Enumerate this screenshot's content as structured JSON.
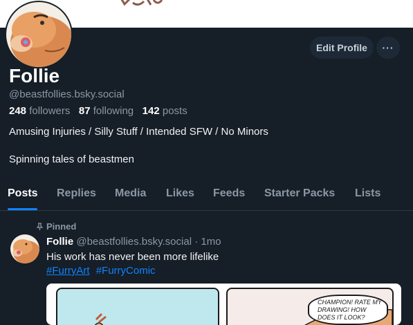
{
  "profile": {
    "display_name": "Follie",
    "handle": "@beastfollies.bsky.social",
    "followers_count": "248",
    "followers_label": "followers",
    "following_count": "87",
    "following_label": "following",
    "posts_count": "142",
    "posts_label": "posts",
    "bio_line1": "Amusing Injuries / Silly Stuff / Intended SFW / No Minors",
    "bio_line2": "Spinning tales of beastmen",
    "edit_button": "Edit Profile",
    "more_button": "···"
  },
  "tabs": [
    {
      "label": "Posts",
      "active": true
    },
    {
      "label": "Replies"
    },
    {
      "label": "Media"
    },
    {
      "label": "Likes"
    },
    {
      "label": "Feeds"
    },
    {
      "label": "Starter Packs"
    },
    {
      "label": "Lists"
    }
  ],
  "post": {
    "pinned_label": "Pinned",
    "author": "Follie",
    "handle": "@beastfollies.bsky.social",
    "separator": "·",
    "time": "1mo",
    "text": "His work has never been more lifelike",
    "tags": [
      "#FurryArt",
      "#FurryComic"
    ],
    "image_caption": "CHAMPION! RATE MY DRAWING! HOW DOES IT LOOK?"
  },
  "colors": {
    "background": "#161e27",
    "accent": "#1083fe",
    "muted_text": "#8b98a5",
    "button_bg": "#1e2937"
  }
}
